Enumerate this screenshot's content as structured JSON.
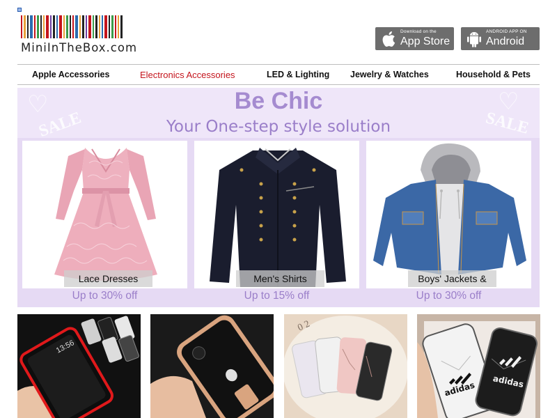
{
  "logo": {
    "text": "MiniInTheBox.com"
  },
  "store_badges": {
    "appstore": {
      "small": "Download on the",
      "big": "App Store"
    },
    "android": {
      "small": "ANDROID APP ON",
      "big": "Android"
    }
  },
  "nav": {
    "items": [
      {
        "label": "Apple Accessories"
      },
      {
        "label": "Electronics Accessories"
      },
      {
        "label": "LED & Lighting"
      },
      {
        "label": "Jewelry & Watches"
      },
      {
        "label": "Household & Pets"
      }
    ],
    "active_index": 1
  },
  "banner": {
    "title": "Be Chic",
    "subtitle": "Your One-step style solution",
    "deco_text": "SALE",
    "cards": [
      {
        "label": "Lace Dresses",
        "discount": "Up to 30% off"
      },
      {
        "label": "Men's Shirts",
        "discount": "Up to 15% off"
      },
      {
        "label": "Boys' Jackets & Coats",
        "discount": "Up to 30% off"
      }
    ]
  },
  "thumbs": {
    "phone_time": "13:56",
    "brand_text": "adidas"
  },
  "colors": {
    "accent_red": "#c4141c",
    "banner_lilac": "#e6daf4",
    "banner_text": "#a58bd0",
    "badge_gray": "#6d6d6d"
  }
}
